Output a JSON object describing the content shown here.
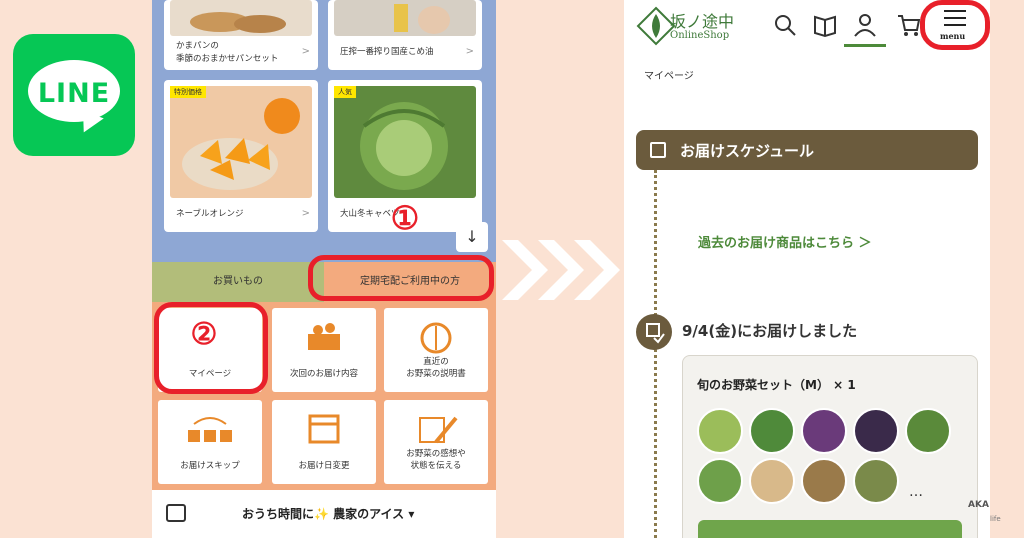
{
  "line_logo": {
    "text": "LINE",
    "color": "#06c755"
  },
  "phone1": {
    "products": [
      {
        "caption": "かまパンの\n季節のおまかせパンセット",
        "tag": ""
      },
      {
        "caption": "圧搾一番搾り国産こめ油",
        "tag": ""
      },
      {
        "caption": "ネーブルオレンジ",
        "tag": "特別価格"
      },
      {
        "caption": "大山冬キャベツ",
        "tag": "人気"
      }
    ],
    "tabs": {
      "shopping": "お買いもの",
      "subscriber": "定期宅配ご利用中の方"
    },
    "tiles": [
      {
        "label": "マイページ",
        "icon": "mypage-icon"
      },
      {
        "label": "次回のお届け内容",
        "icon": "box-vegetables-icon"
      },
      {
        "label": "直近の\nお野菜の説明書",
        "icon": "onion-icon"
      },
      {
        "label": "お届けスキップ",
        "icon": "skip-boxes-icon"
      },
      {
        "label": "お届け日変更",
        "icon": "calendar-icon"
      },
      {
        "label": "お野菜の感想や\n状態を伝える",
        "icon": "pen-feedback-icon"
      }
    ],
    "footer_text": "おうち時間に✨ 農家のアイス ▾",
    "step_numbers": [
      "①",
      "②"
    ]
  },
  "phone2": {
    "shop_name": "坂ノ途中",
    "shop_sub": "OnlineShop",
    "menu_label": "menu",
    "breadcrumb": "マイページ",
    "schedule_title": "お届けスケジュール",
    "past_link": "過去のお届け商品はこちら ＞",
    "delivery_date": "9/4(金)にお届けしました",
    "order_title": "旬のお野菜セット（M） × 1",
    "more": "…"
  },
  "watermark": {
    "line1": "AKA",
    "line2": "life"
  },
  "colors": {
    "accent_red": "#e8202a",
    "brown": "#6b5b3d",
    "green": "#4d8a3a"
  }
}
